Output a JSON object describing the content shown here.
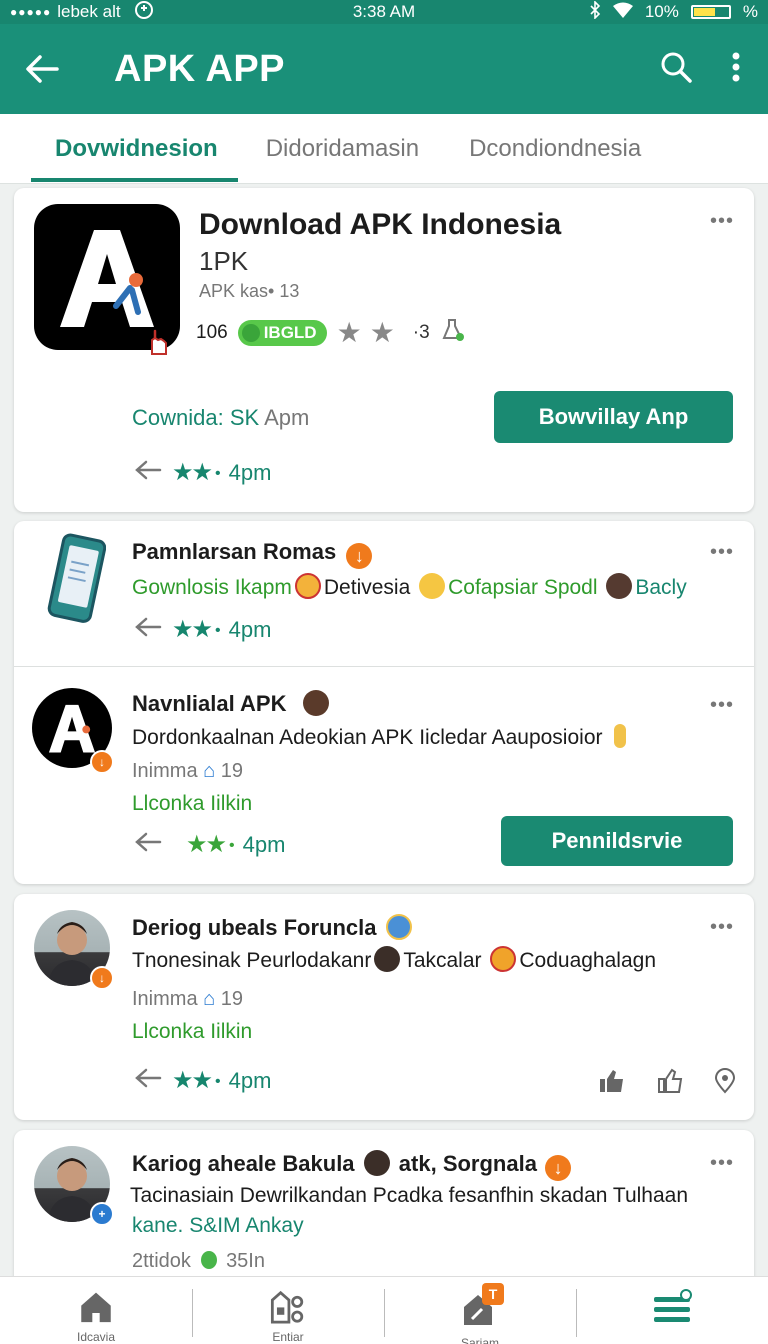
{
  "status_bar": {
    "carrier": "lebek alt",
    "time": "3:38 AM",
    "battery": "10%",
    "battery_suffix": "%"
  },
  "app_bar": {
    "title": "APK APP",
    "icons": [
      "back-arrow-icon",
      "search-icon",
      "more-vert-icon"
    ]
  },
  "tabs": [
    {
      "label": "Dovwidnesion",
      "active": true
    },
    {
      "label": "Didoridamasin",
      "active": false
    },
    {
      "label": "Dcondiondnesia",
      "active": false
    }
  ],
  "featured": {
    "title": "Download APK Indonesia",
    "subtitle": "1PK",
    "meta": "APK kas• 13",
    "count": "106",
    "badge": "IBGLD",
    "extra": "·3",
    "link": "Cownida: SK",
    "link_suffix": "Apm",
    "button": "Bowvillay Anp",
    "time": "4pm",
    "more": "•••"
  },
  "list": [
    {
      "title": "Pamnlarsan Romas",
      "line": [
        {
          "text": "Gownlosis Ikapm",
          "color": "green"
        },
        {
          "text": "Detivesia",
          "color": "dark"
        },
        {
          "text": "Cofapsiar Spodl",
          "color": "green"
        },
        {
          "text": "Bacly",
          "color": "teal"
        }
      ],
      "time": "4pm",
      "more": "•••"
    },
    {
      "title": "Navnlialal APK",
      "desc": "Dordonkaalnan Adeokian APK Iicledar Aauposioior",
      "meta_label": "Inimma",
      "meta_count": "19",
      "link": "Llconka Iilkin",
      "button": "Pennildsrvie",
      "time": "4pm",
      "more": "•••"
    },
    {
      "title": "Deriog ubeals Foruncla",
      "line": [
        {
          "text": "Tnonesinak Peurlodakanr",
          "color": "dark"
        },
        {
          "text": "Takcalar",
          "color": "dark"
        },
        {
          "text": "Coduaghalagn",
          "color": "dark"
        }
      ],
      "meta_label": "Inimma",
      "meta_count": "19",
      "link": "Llconka Iilkin",
      "time": "4pm",
      "more": "•••"
    },
    {
      "title": "Kariog aheale Bakula",
      "title_suffix": "atk, Sorgnala",
      "desc": "Tacinasiain Dewrilkandan Pcadka fesanfhin skadan Tulhaan",
      "link": "kane. S&IM Ankay",
      "meta_label": "2ttidok",
      "meta_count": "35In",
      "more": "•••"
    }
  ],
  "bottom_nav": [
    {
      "label": "Idcavia",
      "icon": "home-icon"
    },
    {
      "label": "Entiar",
      "icon": "apps-icon"
    },
    {
      "label": "Sariam",
      "icon": "updates-icon",
      "badge": "T"
    },
    {
      "label": "",
      "icon": "menu-icon"
    }
  ],
  "colors": {
    "primary": "#1a9079",
    "accent": "#18866f",
    "orange": "#f07a1c",
    "light_green": "#58c84a"
  }
}
